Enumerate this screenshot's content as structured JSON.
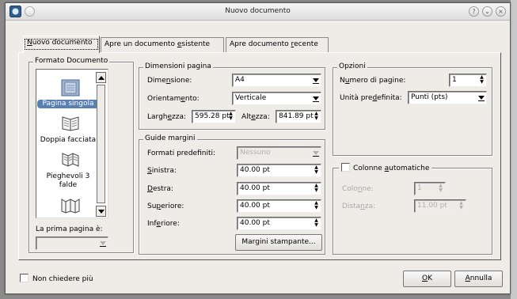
{
  "window": {
    "title": "Nuovo documento",
    "button_help": "?",
    "button_shade": "⌄",
    "button_close": "×"
  },
  "tabs": [
    {
      "label": "Nuovo documento",
      "underline": "N",
      "active": true
    },
    {
      "label": "Apre un documento esistente",
      "active": false
    },
    {
      "label": "Apre documento recente",
      "active": false
    }
  ],
  "formato": {
    "title": "Formato Documento",
    "items": [
      {
        "label": "Pagina singola",
        "icon": "single-page-icon",
        "selected": true
      },
      {
        "label": "Doppia facciata",
        "icon": "facing-pages-icon",
        "selected": false
      },
      {
        "label": "Pieghevoli 3 falde",
        "icon": "three-fold-icon",
        "selected": false
      },
      {
        "label": "",
        "icon": "four-fold-icon",
        "selected": false
      }
    ],
    "first_page_label": "La prima pagina è:",
    "first_page_value": ""
  },
  "dimensioni": {
    "title": "Dimensioni pagina",
    "size_label": "Dimensione:",
    "size_value": "A4",
    "orient_label": "Orientamento:",
    "orient_value": "Verticale",
    "width_label": "Larghezza:",
    "width_value": "595.28 pt",
    "height_label": "Altezza:",
    "height_value": "841.89 pt"
  },
  "guide": {
    "title": "Guide margini",
    "preset_label": "Formati predefiniti:",
    "preset_value": "Nessuno",
    "left_label": "Sinistra:",
    "left_value": "40.00 pt",
    "right_label": "Destra:",
    "right_value": "40.00 pt",
    "top_label": "Superiore:",
    "top_value": "40.00 pt",
    "bottom_label": "Inferiore:",
    "bottom_value": "40.00 pt",
    "print_margins_button": "Margini stampante..."
  },
  "opzioni": {
    "title": "Opzioni",
    "pages_label": "Numero di pagine:",
    "pages_value": "1",
    "unit_label": "Unità predefinita:",
    "unit_value": "Punti (pts)"
  },
  "colonne": {
    "title": "Colonne automatiche",
    "checked": false,
    "columns_label": "Colonne:",
    "columns_value": "1",
    "gap_label": "Distanza:",
    "gap_value": "11.00 pt"
  },
  "footer": {
    "dont_ask_label": "Non chiedere più",
    "dont_ask_checked": false,
    "ok_button": "OK",
    "cancel_button": "Annulla"
  },
  "colors": {
    "selection": "#5a7fb3",
    "dialog_bg": "#efebe7",
    "disabled_text": "#a8a8a8"
  }
}
